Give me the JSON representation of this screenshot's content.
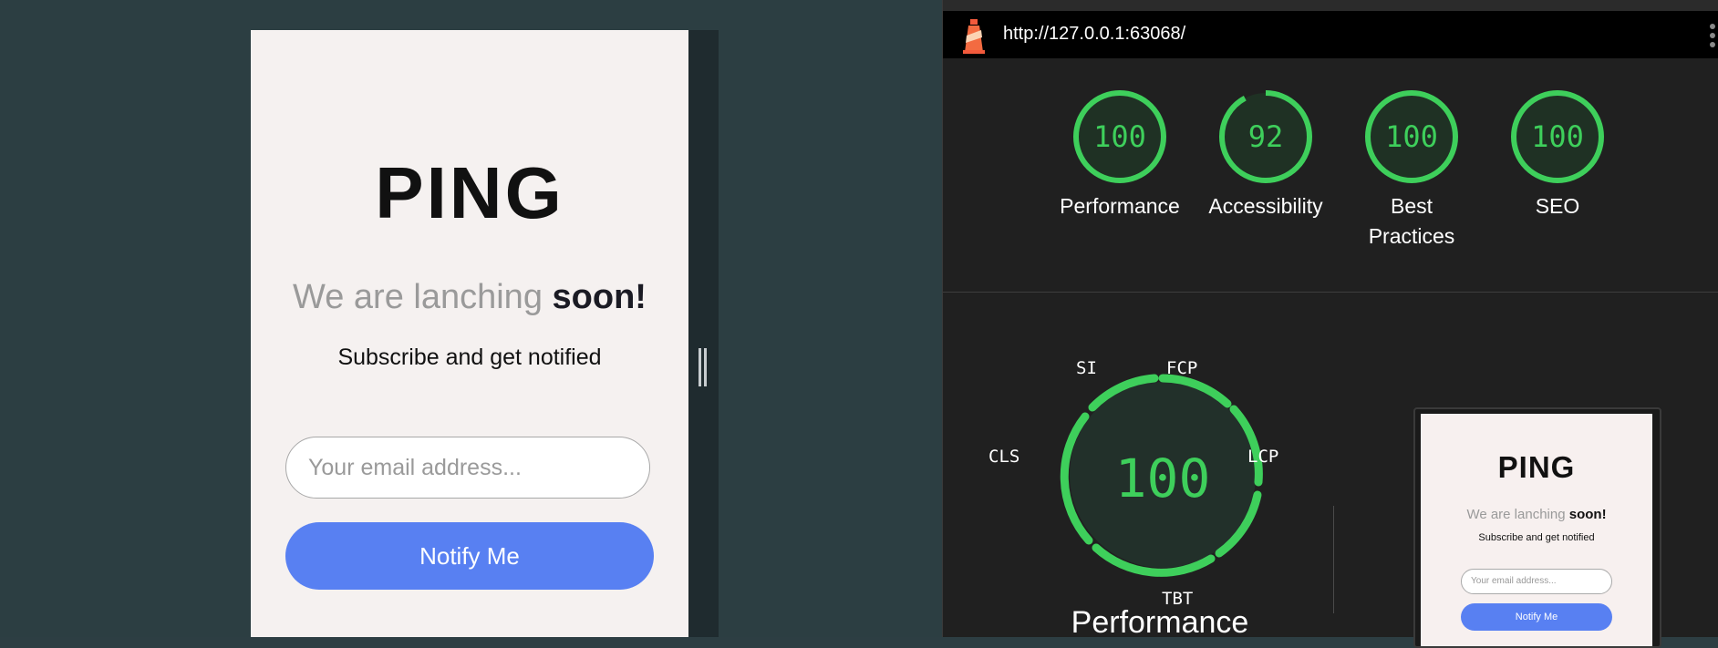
{
  "app": {
    "logo": "PING",
    "headline_light": "We are lanching",
    "headline_bold": "soon!",
    "subtitle": "Subscribe and get notified",
    "email_placeholder": "Your email address...",
    "notify_label": "Notify Me"
  },
  "lighthouse": {
    "url": "http://127.0.0.1:63068/",
    "scores": [
      {
        "value": "100",
        "label": "Performance",
        "fraction": 1.0
      },
      {
        "value": "92",
        "label": "Accessibility",
        "fraction": 0.92
      },
      {
        "value": "100",
        "label_line1": "Best",
        "label_line2": "Practices",
        "fraction": 1.0
      },
      {
        "value": "100",
        "label": "SEO",
        "fraction": 1.0
      }
    ],
    "performance_big": {
      "value": "100",
      "title": "Performance",
      "metrics": {
        "si": "SI",
        "fcp": "FCP",
        "lcp": "LCP",
        "tbt": "TBT",
        "cls": "CLS"
      }
    },
    "thumbnail": {
      "logo": "PING",
      "headline_light": "We are lanching",
      "headline_bold": "soon!",
      "subtitle": "Subscribe and get notified",
      "email_placeholder": "Your email address...",
      "notify_label": "Notify Me"
    }
  },
  "colors": {
    "accent": "#5880f2",
    "score_green": "#3ecf5b",
    "app_bg": "#f5f1f0",
    "backdrop": "#2c3e42"
  }
}
